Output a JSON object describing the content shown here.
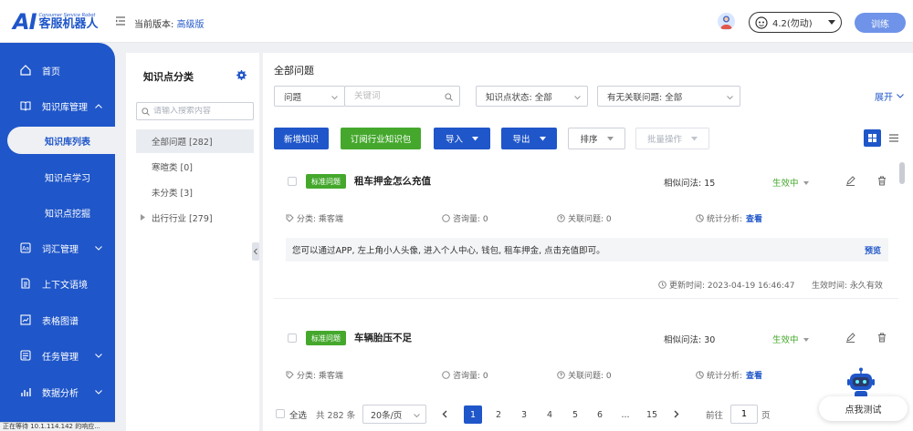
{
  "brand": {
    "logo_ai": "AI",
    "logo_en": "Consumer Service Robot",
    "logo_cn": "客服机器人"
  },
  "header": {
    "version_label": "当前版本:",
    "version_value": "高级版",
    "engine_select": "4.2(勿动)",
    "train_button": "训练"
  },
  "sidebar": {
    "items": [
      {
        "label": "首页",
        "icon": "home-icon"
      },
      {
        "label": "知识库管理",
        "icon": "book-icon"
      },
      {
        "label": "知识库列表"
      },
      {
        "label": "知识点学习"
      },
      {
        "label": "知识点挖掘"
      },
      {
        "label": "词汇管理",
        "icon": "vocab-icon"
      },
      {
        "label": "上下文语境",
        "icon": "document-icon"
      },
      {
        "label": "表格图谱",
        "icon": "chart-icon"
      },
      {
        "label": "任务管理",
        "icon": "task-icon"
      },
      {
        "label": "数据分析",
        "icon": "analytics-icon"
      }
    ]
  },
  "categories": {
    "title": "知识点分类",
    "search_placeholder": "请输入搜索内容",
    "items": [
      {
        "label": "全部问题 [282]"
      },
      {
        "label": "寒暄类 [0]"
      },
      {
        "label": "未分类 [3]"
      },
      {
        "label": "出行行业 [279]"
      }
    ]
  },
  "main": {
    "title": "全部问题",
    "filters": {
      "type": "问题",
      "keyword_placeholder": "关键词",
      "status": "知识点状态: 全部",
      "relation": "有无关联问题: 全部",
      "expand": "展开"
    },
    "toolbar": {
      "add": "新增知识",
      "subscribe": "订阅行业知识包",
      "import": "导入",
      "export": "导出",
      "sort": "排序",
      "batch": "批量操作"
    },
    "cards": [
      {
        "tag": "标准问题",
        "title": "租车押金怎么充值",
        "similar": "相似问法: 15",
        "status": "生效中",
        "category": "分类: 乘客端",
        "consult": "咨询量: 0",
        "related": "关联问题: 0",
        "stats": "统计分析:",
        "stats_link": "查看",
        "answer": "您可以通过APP, 左上角小人头像, 进入个人中心, 钱包, 租车押金, 点击充值即可。",
        "preview": "预览",
        "updated": "更新时间: 2023-04-19 16:46:47",
        "effective": "生效时间: 永久有效"
      },
      {
        "tag": "标准问题",
        "title": "车辆胎压不足",
        "similar": "相似问法: 30",
        "status": "生效中",
        "category": "分类: 乘客端",
        "consult": "咨询量: 0",
        "related": "关联问题: 0",
        "stats": "统计分析:",
        "stats_link": "查看"
      }
    ],
    "pager": {
      "select_all": "全选",
      "total": "共 282 条",
      "page_size": "20条/页",
      "pages": [
        "1",
        "2",
        "3",
        "4",
        "5",
        "6",
        "...",
        "15"
      ],
      "current": "1",
      "goto_label": "前往",
      "goto_value": "1",
      "page_unit": "页"
    }
  },
  "test_button": "点我测试",
  "statusbar": "正在等待 10.1.114.142 的响应...",
  "colors": {
    "primary": "#1f56c9",
    "green": "#45a82d"
  }
}
